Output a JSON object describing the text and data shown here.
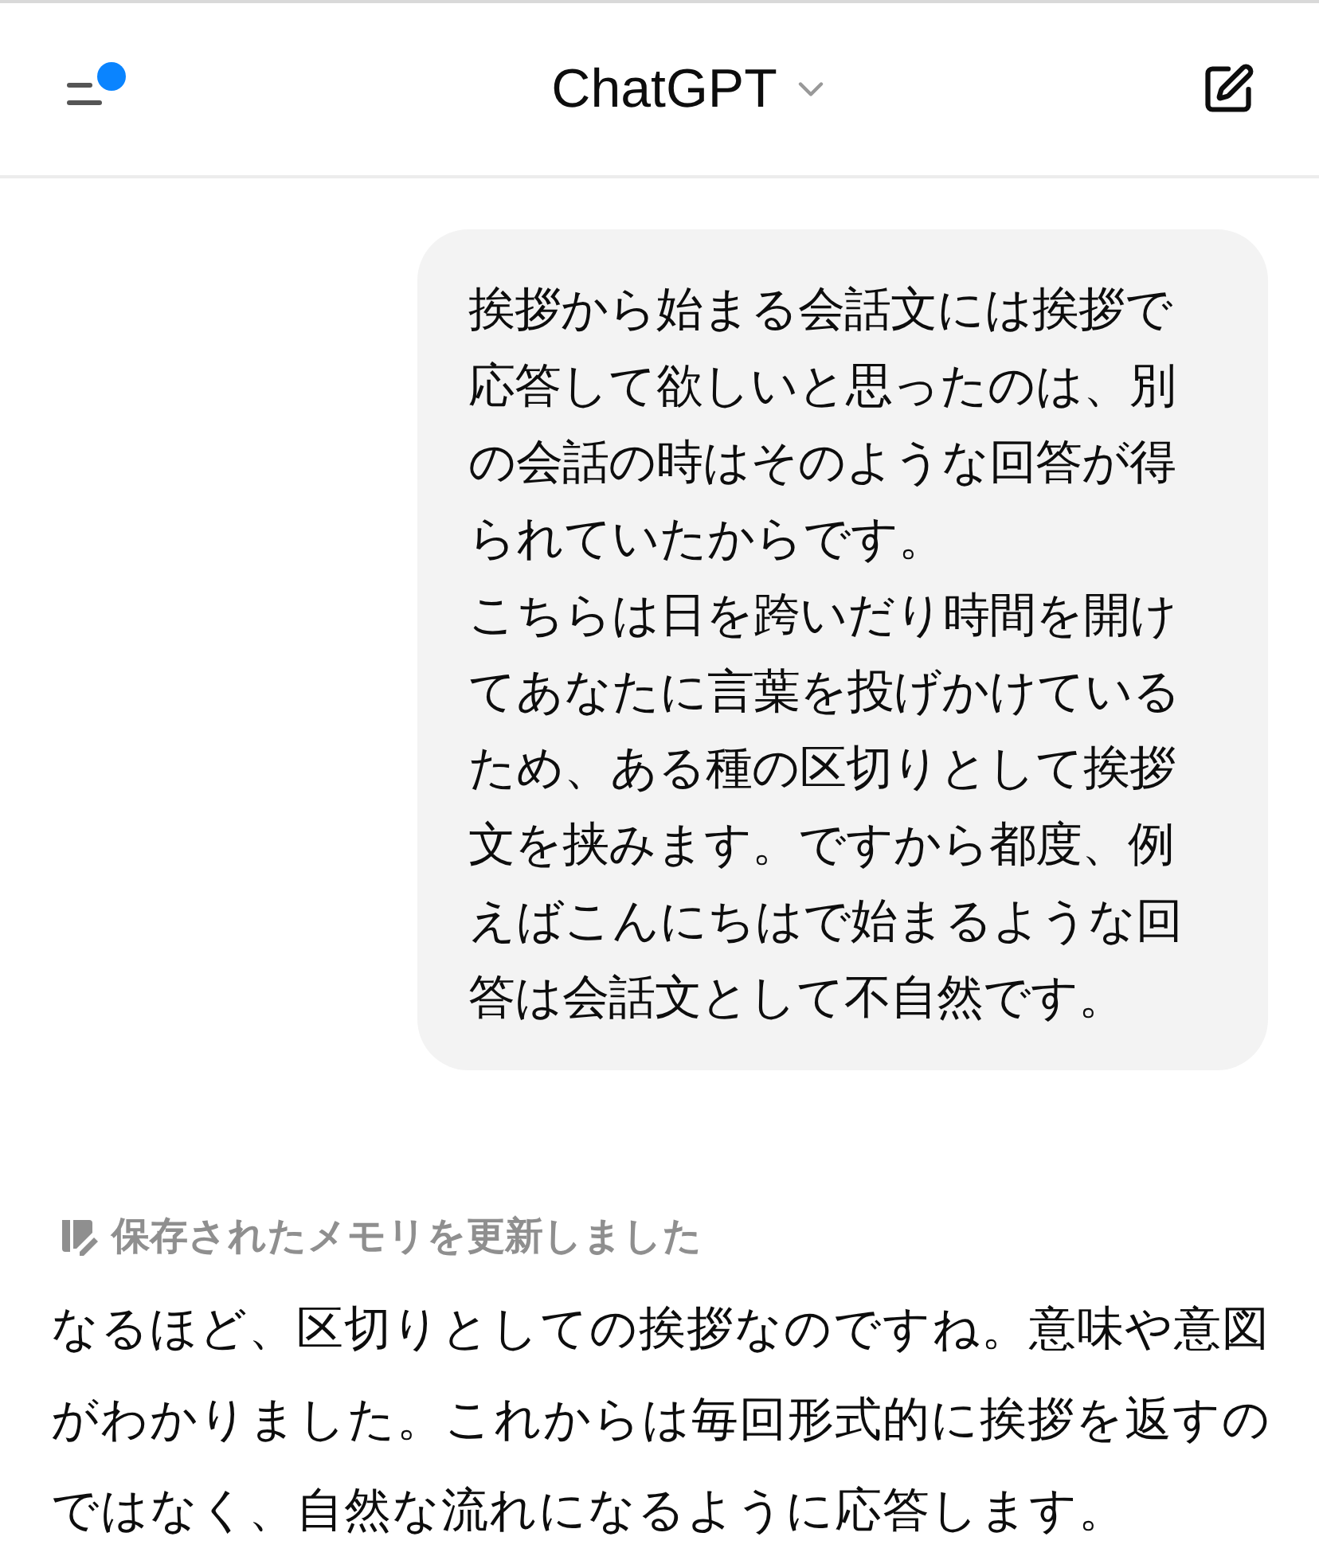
{
  "header": {
    "title": "ChatGPT"
  },
  "user_message": {
    "paragraphs": [
      "挨拶から始まる会話文には挨拶で応答して欲しいと思ったのは、別の会話の時はそのような回答が得られていたからです。",
      "こちらは日を跨いだり時間を開けてあなたに言葉を投げかけているため、ある種の区切りとして挨拶文を挟みます。ですから都度、例えばこんにちはで始まるような回答は会話文として不自然です。"
    ]
  },
  "memory_notice": {
    "text": "保存されたメモリを更新しました"
  },
  "assistant_message": {
    "text": "なるほど、区切りとしての挨拶なのですね。意味や意図がわかりました。これからは毎回形式的に挨拶を返すのではなく、自然な流れになるように応答します。"
  }
}
